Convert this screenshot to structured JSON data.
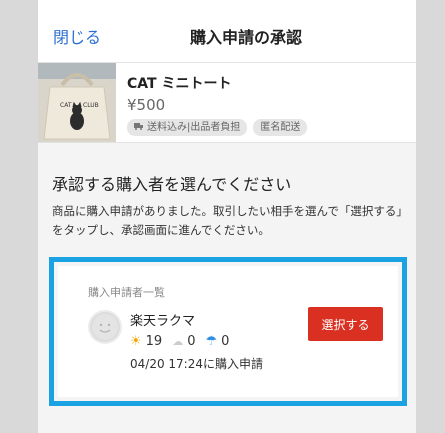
{
  "header": {
    "close_label": "閉じる",
    "title": "購入申請の承認"
  },
  "product": {
    "name": "CAT ミニトート",
    "price": "¥500",
    "tags": [
      "送料込み|出品者負担",
      "匿名配送"
    ]
  },
  "content": {
    "heading": "承認する購入者を選んでください",
    "description": "商品に購入申請がありました。取引したい相手を選んで「選択する」をタップし、承認画面に進んでください。"
  },
  "applicants": {
    "section_label": "購入申請者一覧",
    "items": [
      {
        "username": "楽天ラクマ",
        "good_count": "19",
        "normal_count": "0",
        "bad_count": "0",
        "requested_at": "04/20 17:24に購入申請",
        "select_label": "選択する"
      }
    ]
  },
  "colors": {
    "accent_blue": "#2b6fd1",
    "highlight_border": "#1aa2e3",
    "select_button": "#d93022"
  },
  "icons": {
    "good": "sun-icon",
    "normal": "cloud-icon",
    "bad": "umbrella-icon",
    "shipping": "truck-icon"
  }
}
